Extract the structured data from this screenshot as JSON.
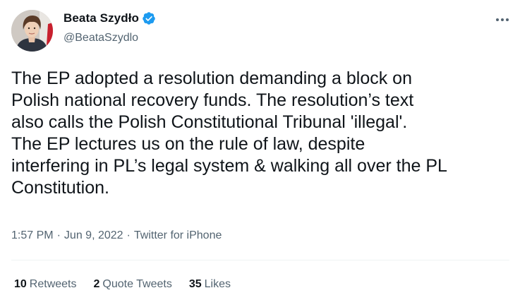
{
  "author": {
    "display_name": "Beata Szydło",
    "handle": "@BeataSzydlo",
    "verified_icon": "verified-badge-icon",
    "verified_color": "#1d9bf0"
  },
  "tweet": {
    "lines": [
      "The EP adopted a resolution demanding a block on",
      "Polish national recovery funds. The resolution’s text",
      "also calls the Polish Constitutional Tribunal 'illegal'.",
      "The EP lectures us on the rule of law, despite",
      "interfering in PL’s legal system & walking all over the PL",
      "Constitution."
    ],
    "time": "1:57 PM",
    "date": "Jun 9, 2022",
    "source": "Twitter for iPhone",
    "separator": "·"
  },
  "stats": {
    "retweets": {
      "count": "10",
      "label": "Retweets"
    },
    "quote_tweets": {
      "count": "2",
      "label": "Quote Tweets"
    },
    "likes": {
      "count": "35",
      "label": "Likes"
    }
  },
  "colors": {
    "text": "#0f1419",
    "secondary": "#536471",
    "divider": "#eff3f4"
  }
}
